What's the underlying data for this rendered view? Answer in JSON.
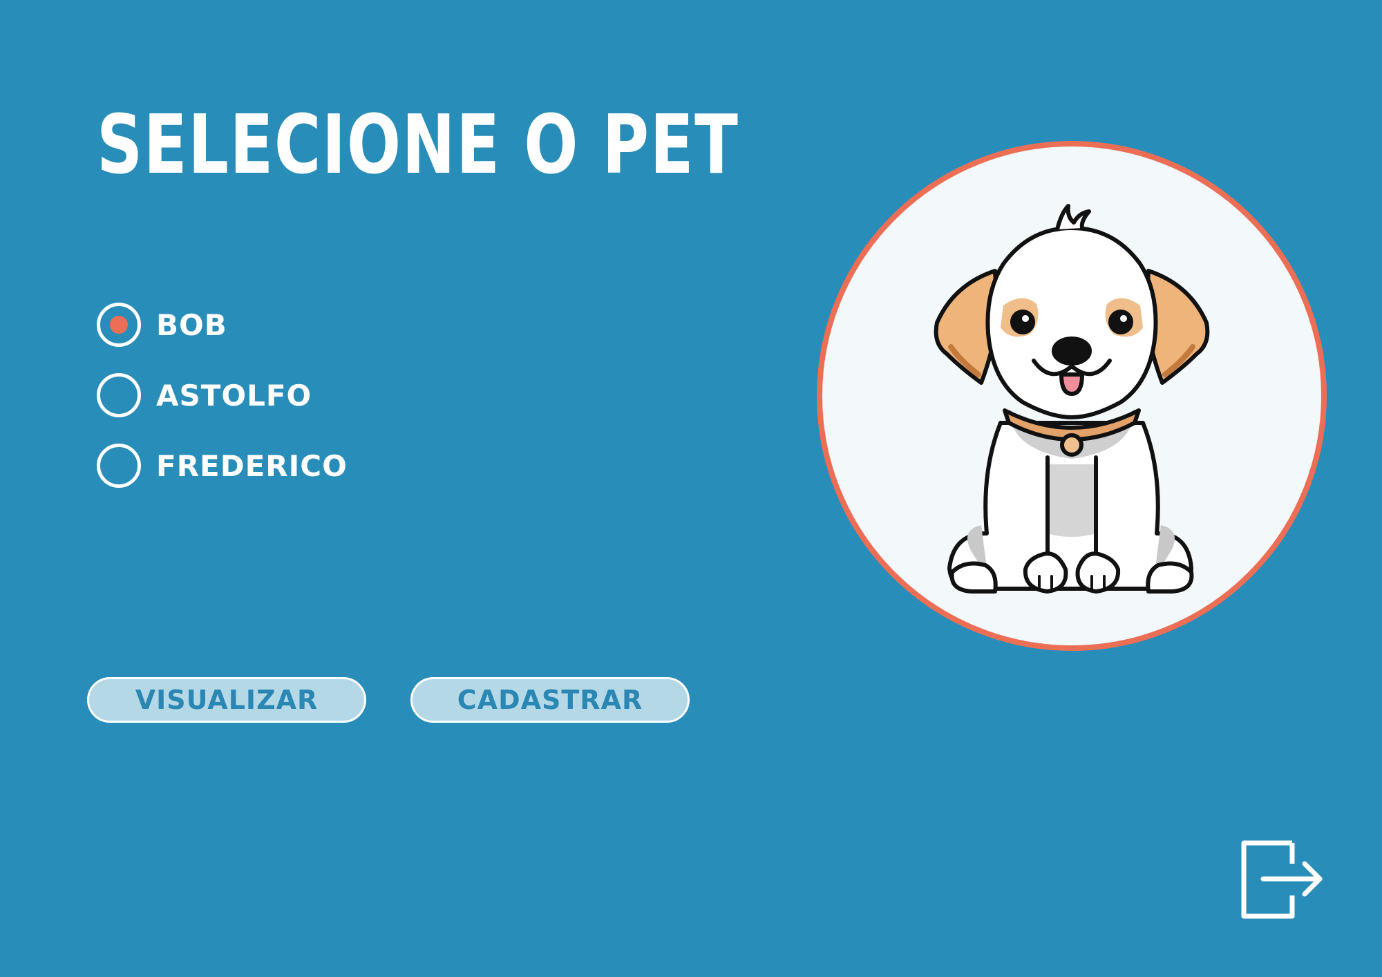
{
  "title": "SELECIONE O PET",
  "pets": [
    {
      "label": "BOB",
      "selected": true
    },
    {
      "label": "ASTOLFO",
      "selected": false
    },
    {
      "label": "FREDERICO",
      "selected": false
    }
  ],
  "buttons": {
    "visualizar": "VISUALIZAR",
    "cadastrar": "CADASTRAR"
  },
  "icons": {
    "pet_avatar": "dog-illustration-icon",
    "logout": "logout-icon"
  },
  "colors": {
    "background": "#288db9",
    "accent": "#ec6f55",
    "button_fill": "#b4d8e6",
    "button_text": "#2a86b3"
  }
}
